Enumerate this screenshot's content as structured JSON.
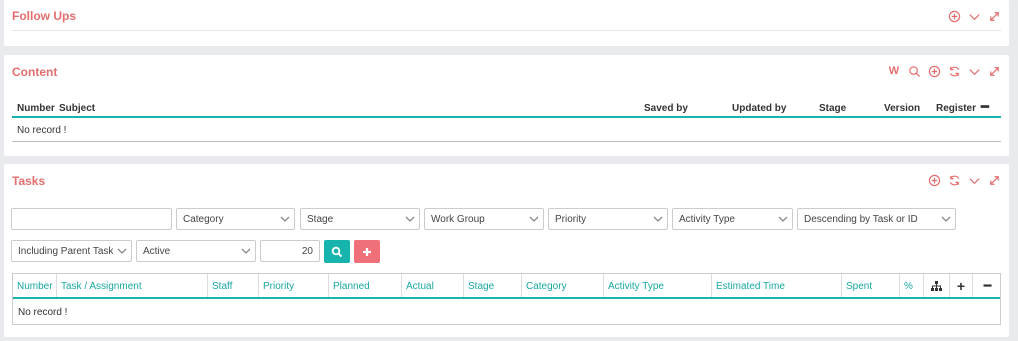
{
  "follow_ups": {
    "title": "Follow Ups",
    "icons": [
      "add-circle-icon",
      "chevron-down-icon",
      "expand-icon"
    ]
  },
  "content": {
    "title": "Content",
    "tool_letter": "W",
    "icons": [
      "word-icon",
      "search-icon",
      "add-circle-icon",
      "refresh-icon",
      "chevron-down-icon",
      "expand-icon"
    ],
    "columns": [
      "Number",
      "Subject",
      "Saved by",
      "Updated by",
      "Stage",
      "Version",
      "Register"
    ],
    "empty": "No record !"
  },
  "tasks": {
    "title": "Tasks",
    "icons": [
      "add-circle-icon",
      "refresh-icon",
      "chevron-down-icon",
      "expand-icon"
    ],
    "filters": {
      "search_value": "",
      "category": "Category",
      "stage": "Stage",
      "work_group": "Work Group",
      "priority": "Priority",
      "activity_type": "Activity Type",
      "sort": "Descending by Task or ID",
      "parent_tasks": "Including Parent Tasks",
      "status": "Active",
      "page_size": "20"
    },
    "search_button_color": "#17b4ae",
    "add_button_color": "#f0707a",
    "columns": [
      "Number",
      "Task / Assignment",
      "Staff",
      "Priority",
      "Planned",
      "Actual",
      "Stage",
      "Category",
      "Activity Type",
      "Estimated Time",
      "Spent",
      "%"
    ],
    "empty": "No record !"
  }
}
